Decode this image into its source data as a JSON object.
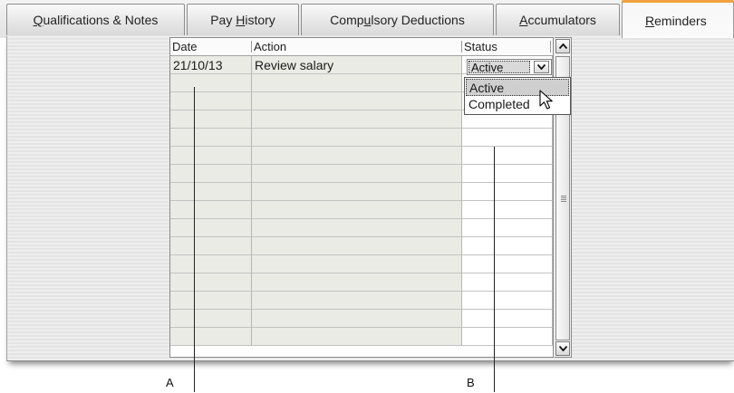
{
  "tabs": [
    {
      "label_pre": "",
      "mnemonic": "Q",
      "label_post": "ualifications & Notes"
    },
    {
      "label_pre": "Pay ",
      "mnemonic": "H",
      "label_post": "istory"
    },
    {
      "label_pre": "Comp",
      "mnemonic": "u",
      "label_post": "lsory Deductions"
    },
    {
      "label_pre": "",
      "mnemonic": "A",
      "label_post": "ccumulators"
    },
    {
      "label_pre": "",
      "mnemonic": "R",
      "label_post": "eminders"
    }
  ],
  "grid": {
    "columns": [
      "Date",
      "Action",
      "Status"
    ],
    "rows": [
      {
        "date": "21/10/13",
        "action": "Review salary",
        "status": "Active"
      }
    ]
  },
  "status_dropdown": {
    "options": [
      "Active",
      "Completed"
    ],
    "highlighted": "Active"
  },
  "callouts": {
    "a": "A",
    "b": "B"
  },
  "icons": {
    "scroll_up": "arrow-up-icon",
    "scroll_down": "arrow-down-icon",
    "combo": "chevron-down-icon",
    "cursor": "mouse-pointer-icon"
  },
  "colors": {
    "active_tab_accent": "#f0a23c"
  }
}
